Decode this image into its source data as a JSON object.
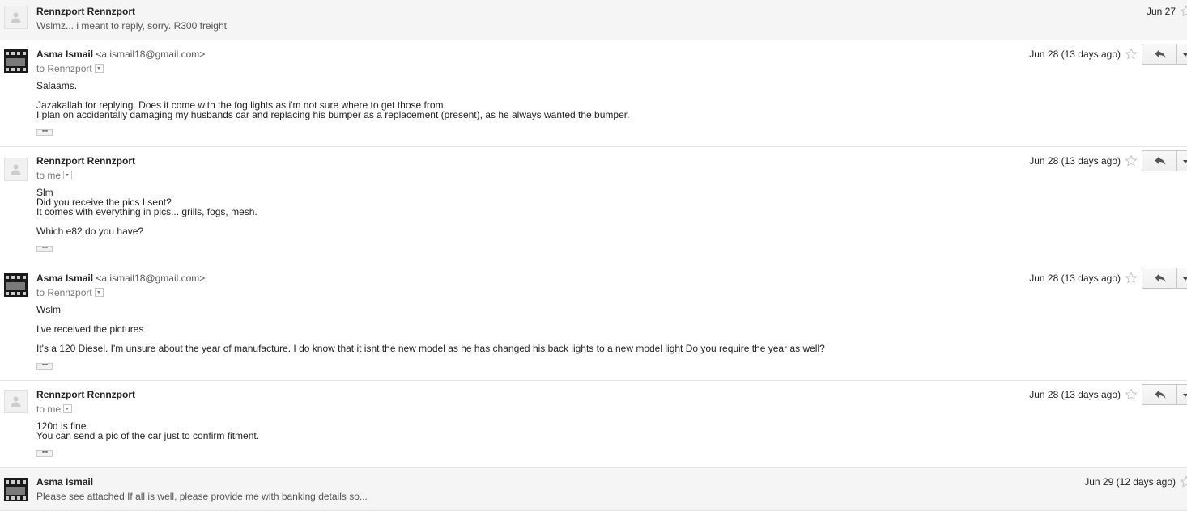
{
  "messages": [
    {
      "sender": "Rennzport Rennzport",
      "snippet": "Wslmz... i meant to reply, sorry. R300 freight",
      "date": "Jun 27"
    },
    {
      "sender": "Asma Ismail",
      "email": "<a.ismail18@gmail.com>",
      "recipient": "to Rennzport",
      "body": [
        "Salaams.",
        "Jazakallah for replying. Does it come with the fog lights as i'm not sure where to get those from.\nI plan on accidentally damaging my husbands car and replacing his bumper as a replacement (present), as he always wanted the bumper."
      ],
      "date": "Jun 28 (13 days ago)"
    },
    {
      "sender": "Rennzport Rennzport",
      "recipient": "to me",
      "body": [
        "Slm\nDid you receive the pics I sent?\nIt comes with everything in pics... grills, fogs, mesh.",
        "Which e82 do you have?"
      ],
      "date": "Jun 28 (13 days ago)"
    },
    {
      "sender": "Asma Ismail",
      "email": "<a.ismail18@gmail.com>",
      "recipient": "to Rennzport",
      "body": [
        "Wslm",
        "I've received the pictures",
        "It's a 120 Diesel. I'm unsure about the year of manufacture. I do know that it isnt the new model as he has changed his back lights to a new model light Do you require the year as well?"
      ],
      "date": "Jun 28 (13 days ago)"
    },
    {
      "sender": "Rennzport Rennzport",
      "recipient": "to me",
      "body": [
        "120d is fine.\nYou can send a pic of the car just to confirm fitment."
      ],
      "date": "Jun 28 (13 days ago)"
    },
    {
      "sender": "Asma Ismail",
      "snippet": "Please see attached If all is well, please provide me with banking details so...",
      "date": "Jun 29 (12 days ago)"
    }
  ],
  "icons": {
    "avatar_default": "person-icon",
    "star": "star-icon",
    "reply": "reply-arrow-icon",
    "more": "chevron-down-icon"
  },
  "colors": {
    "collapsed_bg": "#f5f5f5",
    "divider": "#e5e5e5",
    "text": "#222222",
    "muted": "#777777"
  }
}
